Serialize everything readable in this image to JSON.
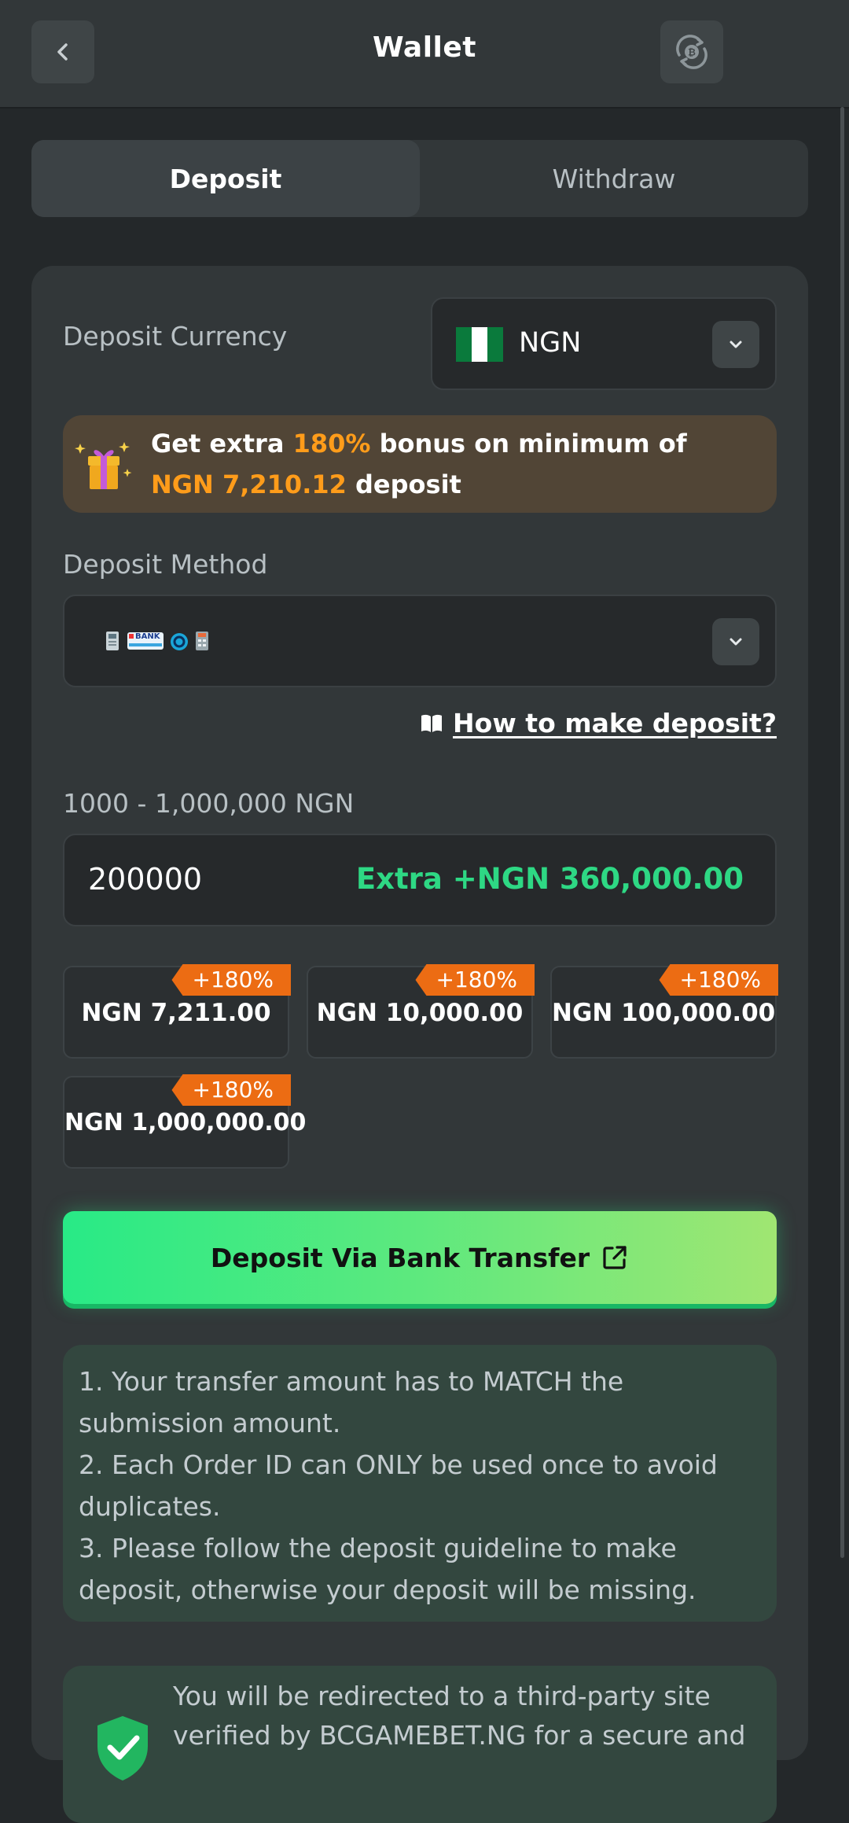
{
  "header": {
    "title": "Wallet",
    "back_icon": "chevron-left-icon",
    "right_icon": "bitcoin-exchange-icon"
  },
  "tabs": [
    {
      "label": "Deposit",
      "active": true
    },
    {
      "label": "Withdraw",
      "active": false
    }
  ],
  "deposit_currency": {
    "label": "Deposit Currency",
    "selected": "NGN",
    "flag_colors": [
      "#0a7a3c",
      "#ffffff",
      "#0a7a3c"
    ]
  },
  "bonus": {
    "prefix": "Get extra ",
    "percent": "180%",
    "middle": " bonus on minimum of",
    "min_amount": "NGN 7,210.12",
    "suffix": " deposit"
  },
  "deposit_method": {
    "label": "Deposit Method",
    "method_icons": [
      "atm-icon",
      "bank-transfer-icon",
      "opay-icon",
      "pos-icon"
    ],
    "bank_badge_text": "BANK"
  },
  "howto": {
    "label": "How to make deposit?"
  },
  "amount": {
    "range_label": "1000 - 1,000,000 NGN",
    "value": "200000",
    "extra": "Extra +NGN 360,000.00"
  },
  "quick_amounts": [
    {
      "label": "NGN 7,211.00",
      "badge": "+180%"
    },
    {
      "label": "NGN 10,000.00",
      "badge": "+180%"
    },
    {
      "label": "NGN 100,000.00",
      "badge": "+180%"
    },
    {
      "label": "NGN 1,000,000.00",
      "badge": "+180%"
    }
  ],
  "cta": {
    "label": "Deposit Via Bank Transfer"
  },
  "notes": [
    "1. Your transfer amount has to MATCH the submission amount.",
    "2. Each Order ID can ONLY be used once to avoid duplicates.",
    "3. Please follow the deposit guideline to make deposit, otherwise your deposit will be missing."
  ],
  "redirect": {
    "text": "You will be redirected to a third-party site verified by BCGAMEBET.NG for a secure and"
  },
  "colors": {
    "accent_green": "#2ed884",
    "accent_orange": "#ff9c1a",
    "badge_orange": "#ec6c13"
  }
}
